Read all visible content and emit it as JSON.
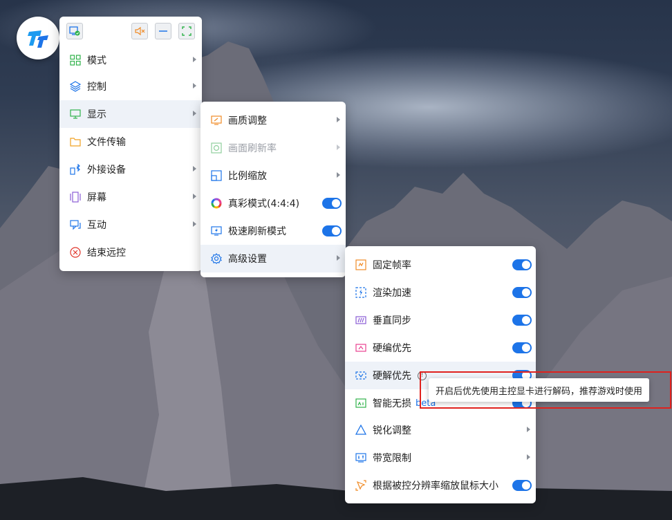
{
  "main_menu": {
    "items": [
      {
        "label": "模式",
        "icon": "grid-icon"
      },
      {
        "label": "控制",
        "icon": "layers-icon"
      },
      {
        "label": "显示",
        "icon": "monitor-icon"
      },
      {
        "label": "文件传输",
        "icon": "folder-icon"
      },
      {
        "label": "外接设备",
        "icon": "bluetooth-device-icon"
      },
      {
        "label": "屏幕",
        "icon": "screens-icon"
      },
      {
        "label": "互动",
        "icon": "chat-icon"
      },
      {
        "label": "结束远控",
        "icon": "close-circle-icon"
      }
    ]
  },
  "display_menu": {
    "items": [
      {
        "label": "画质调整",
        "icon": "quality-icon"
      },
      {
        "label": "画面刷新率",
        "icon": "refresh-rate-icon"
      },
      {
        "label": "比例缩放",
        "icon": "scale-icon"
      },
      {
        "label": "真彩模式(4:4:4)",
        "icon": "color-wheel-icon",
        "toggle": true
      },
      {
        "label": "极速刷新模式",
        "icon": "fast-refresh-icon",
        "toggle": true
      },
      {
        "label": "高级设置",
        "icon": "gear-icon"
      }
    ]
  },
  "advanced_menu": {
    "items": [
      {
        "label": "固定帧率",
        "icon": "fixed-framerate-icon",
        "toggle": true
      },
      {
        "label": "渲染加速",
        "icon": "render-accel-icon",
        "toggle": true
      },
      {
        "label": "垂直同步",
        "icon": "vsync-icon",
        "toggle": true
      },
      {
        "label": "硬编优先",
        "icon": "hw-encode-icon",
        "toggle": true
      },
      {
        "label": "硬解优先",
        "icon": "hw-decode-icon",
        "toggle": true
      },
      {
        "label": "智能无损",
        "badge": "beta",
        "icon": "smart-lossless-icon",
        "toggle": true
      },
      {
        "label": "锐化调整",
        "icon": "triangle-icon"
      },
      {
        "label": "带宽限制",
        "icon": "bandwidth-icon"
      },
      {
        "label": "根据被控分辨率缩放鼠标大小",
        "icon": "cursor-scale-icon",
        "toggle": true
      }
    ]
  },
  "tooltip": {
    "text": "开启后优先使用主控显卡进行解码，推荐游戏时使用"
  },
  "colors": {
    "accent": "#1d74e8",
    "highlight_box": "#e0211d"
  }
}
